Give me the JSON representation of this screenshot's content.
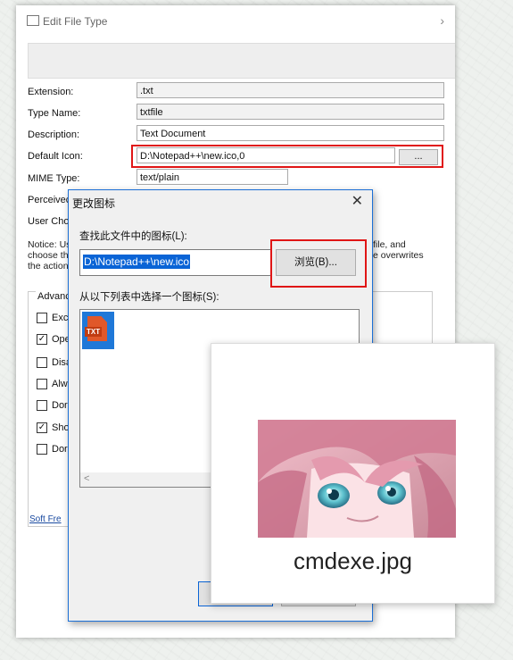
{
  "main_window": {
    "title": "Edit File Type",
    "fields": {
      "extension_label": "Extension:",
      "extension_value": ".txt",
      "type_name_label": "Type Name:",
      "type_name_value": "txtfile",
      "description_label": "Description:",
      "description_value": "Text Document",
      "default_icon_label": "Default Icon:",
      "default_icon_value": "D:\\Notepad++\\new.ico,0",
      "default_icon_browse": "...",
      "mime_type_label": "MIME Type:",
      "mime_type_value": "text/plain",
      "perceived_label": "Perceivec",
      "user_choice_label": "User Choi"
    },
    "notice": {
      "lines": [
        "Notice: Us",
        "choose th",
        "the action"
      ],
      "right_lines": [
        "file, and",
        "e overwrites"
      ]
    },
    "advanced": {
      "label": "Advanc",
      "checkboxes": [
        {
          "label": "Exc",
          "checked": false
        },
        {
          "label": "Ope",
          "checked": true
        },
        {
          "label": "Disa",
          "checked": false
        },
        {
          "label": "Alw",
          "checked": false
        },
        {
          "label": "Dor",
          "checked": false
        },
        {
          "label": "Sho",
          "checked": true
        },
        {
          "label": "Dor",
          "checked": false
        }
      ]
    },
    "footer_link": "Soft Fre"
  },
  "dialog": {
    "title": "更改图标",
    "close": "✕",
    "find_label": "查找此文件中的图标(L):",
    "path_value": "D:\\Notepad++\\new.ico",
    "browse_label": "浏览(B)...",
    "list_label": "从以下列表中选择一个图标(S):",
    "icon_tag": "TXT",
    "scroll_left": "<"
  },
  "overlay_card": {
    "caption": "cmdexe.jpg"
  },
  "colors": {
    "highlight_red": "#e01616",
    "selection_blue": "#0a64d6",
    "dialog_border": "#1b6fd6"
  }
}
